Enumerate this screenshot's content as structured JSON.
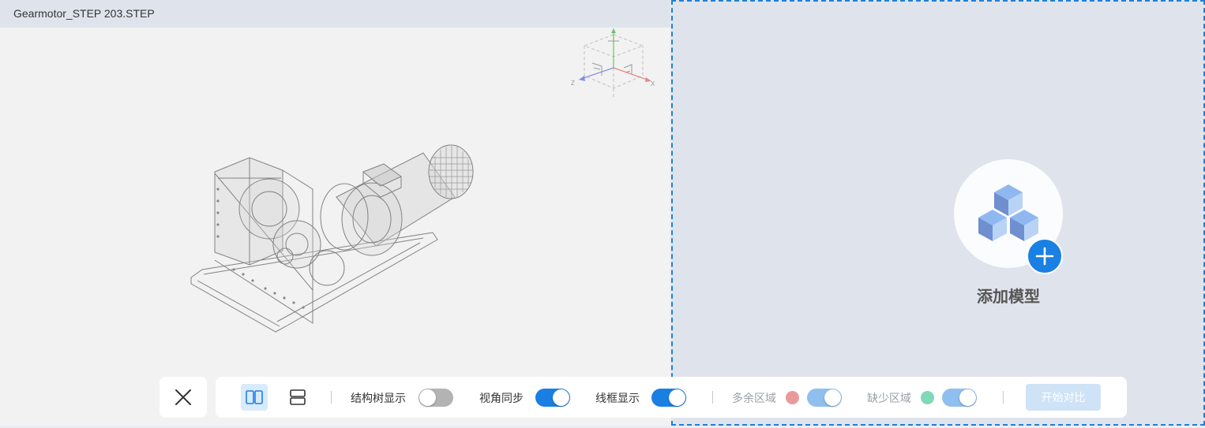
{
  "left_viewer": {
    "file_name": "Gearmotor_STEP 203.STEP",
    "view_cube_axes": {
      "x": "X",
      "z": "Z"
    }
  },
  "right_pane": {
    "add_model_label": "添加模型"
  },
  "toolbar": {
    "structure_tree_label": "结构树显示",
    "structure_tree_on": false,
    "view_sync_label": "视角同步",
    "view_sync_on": true,
    "wireframe_label": "线框显示",
    "wireframe_on": true,
    "extra_region_label": "多余区域",
    "extra_region_color": "#e89a9a",
    "extra_region_on": true,
    "missing_region_label": "缺少区域",
    "missing_region_color": "#7fd8b8",
    "missing_region_on": true,
    "start_compare_label": "开始对比"
  },
  "colors": {
    "accent": "#1a80e3",
    "pane_bg": "#dfe4ec",
    "viewer_bg": "#f2f2f2"
  }
}
